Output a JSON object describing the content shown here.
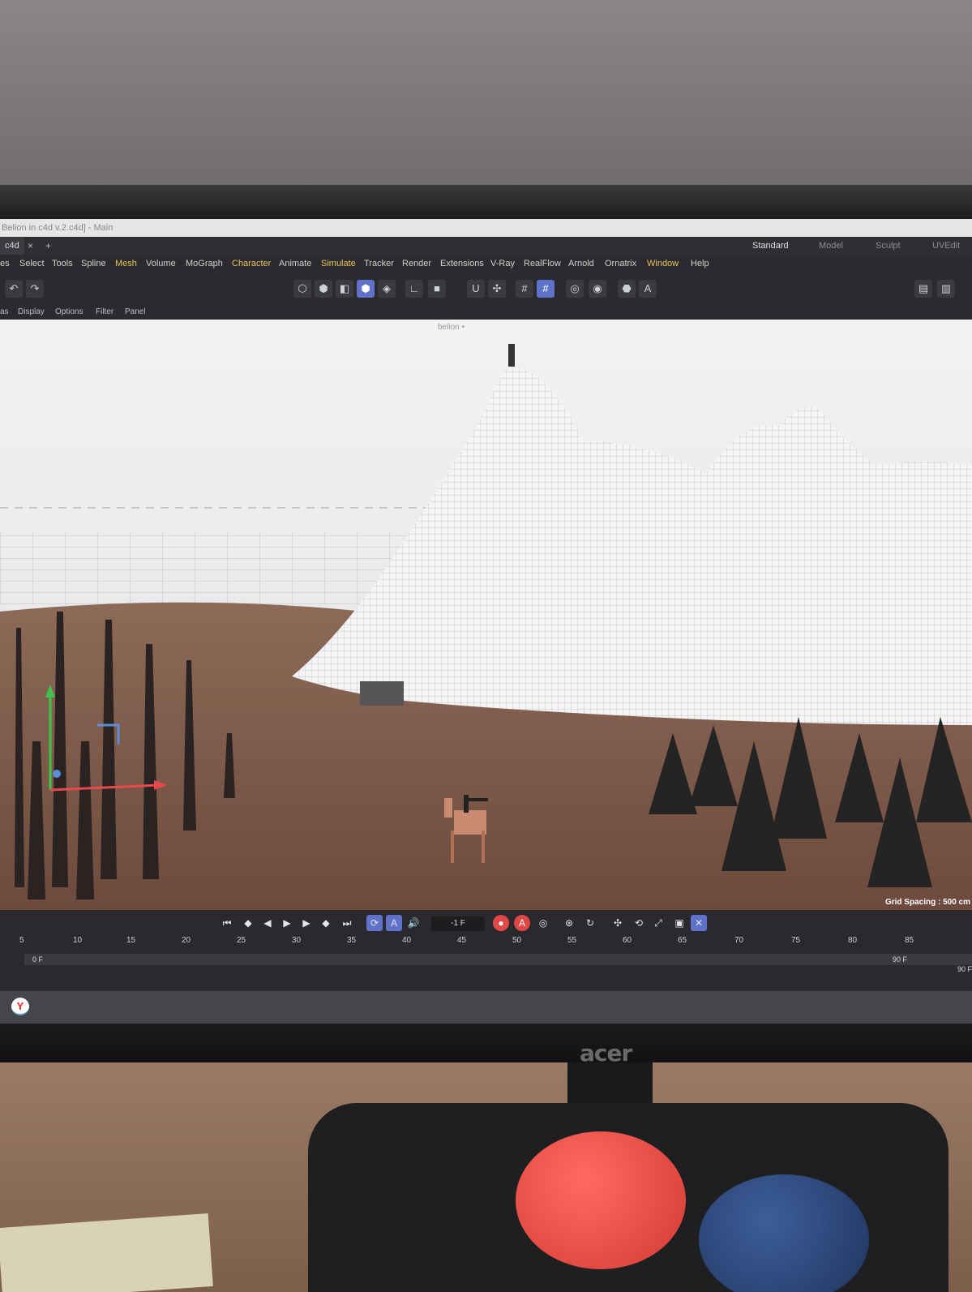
{
  "window": {
    "title": "Belion in c4d v.2.c4d] - Main",
    "doc_tab": "c4d",
    "close": "×",
    "add": "+"
  },
  "layouts": [
    "Standard",
    "Model",
    "Sculpt",
    "UVEdit"
  ],
  "menu": [
    "es",
    "Select",
    "Tools",
    "Spline",
    "Mesh",
    "Volume",
    "MoGraph",
    "Character",
    "Animate",
    "Simulate",
    "Tracker",
    "Render",
    "Extensions",
    "V-Ray",
    "RealFlow",
    "Arnold",
    "Ornatrix",
    "Window",
    "Help"
  ],
  "viewport_menu": [
    "as",
    "Display",
    "Options",
    "Filter",
    "Panel"
  ],
  "viewport": {
    "camera_label": "belion •",
    "grid_spacing": "Grid Spacing : 500 cm"
  },
  "timeline": {
    "current_frame": "-1 F",
    "ticks": [
      "5",
      "10",
      "15",
      "20",
      "25",
      "30",
      "35",
      "40",
      "45",
      "50",
      "55",
      "60",
      "65",
      "70",
      "75",
      "80",
      "85"
    ],
    "range_start": "0 F",
    "range_end": "90 F",
    "range_end_total": "90 F"
  },
  "taskbar": {
    "yandex_glyph": "Y"
  },
  "monitor": {
    "brand": "acer"
  },
  "colors": {
    "accent": "#5f72c9",
    "menu_highlight": "#e8c35a",
    "record": "#e04848"
  }
}
